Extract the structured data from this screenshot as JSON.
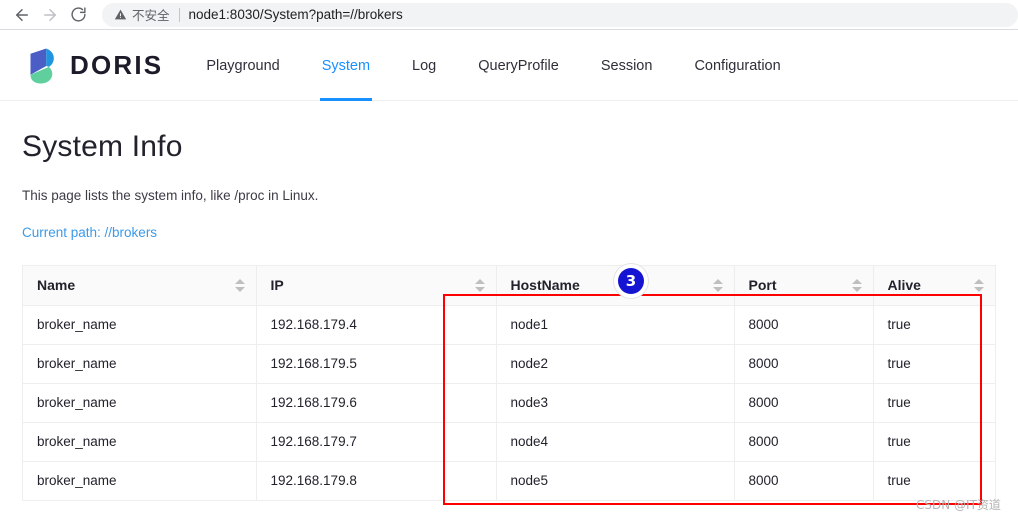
{
  "browser": {
    "back_icon": "arrow-left-icon",
    "forward_icon": "arrow-right-icon",
    "reload_icon": "reload-icon",
    "security_icon": "warning-triangle-icon",
    "security_label": "不安全",
    "url": "node1:8030/System?path=//brokers"
  },
  "header": {
    "logo_icon": "doris-logo-icon",
    "logo_text": "DORIS",
    "logo_colors": {
      "blue": "#4a5ec6",
      "teal": "#5fcf9e",
      "cyan": "#2196e0"
    },
    "nav": [
      {
        "label": "Playground",
        "active": false
      },
      {
        "label": "System",
        "active": true
      },
      {
        "label": "Log",
        "active": false
      },
      {
        "label": "QueryProfile",
        "active": false
      },
      {
        "label": "Session",
        "active": false
      },
      {
        "label": "Configuration",
        "active": false
      }
    ],
    "accent_color": "#1890ff"
  },
  "main": {
    "title": "System Info",
    "description": "This page lists the system info, like /proc in Linux.",
    "current_path": "Current path: //brokers"
  },
  "table": {
    "columns": [
      {
        "label": "Name",
        "sort_icon": "sort-icon"
      },
      {
        "label": "IP",
        "sort_icon": "sort-icon"
      },
      {
        "label": "HostName",
        "sort_icon": "sort-icon"
      },
      {
        "label": "Port",
        "sort_icon": "sort-icon"
      },
      {
        "label": "Alive",
        "sort_icon": "sort-icon"
      }
    ],
    "rows": [
      {
        "name": "broker_name",
        "ip": "192.168.179.4",
        "hostname": "node1",
        "port": "8000",
        "alive": "true"
      },
      {
        "name": "broker_name",
        "ip": "192.168.179.5",
        "hostname": "node2",
        "port": "8000",
        "alive": "true"
      },
      {
        "name": "broker_name",
        "ip": "192.168.179.6",
        "hostname": "node3",
        "port": "8000",
        "alive": "true"
      },
      {
        "name": "broker_name",
        "ip": "192.168.179.7",
        "hostname": "node4",
        "port": "8000",
        "alive": "true"
      },
      {
        "name": "broker_name",
        "ip": "192.168.179.8",
        "hostname": "node5",
        "port": "8000",
        "alive": "true"
      }
    ]
  },
  "annotations": {
    "step_badge": "3",
    "step_badge_color": "#1414d2",
    "highlight_color": "#ff0000",
    "watermark": "CSDN @IT资道"
  }
}
